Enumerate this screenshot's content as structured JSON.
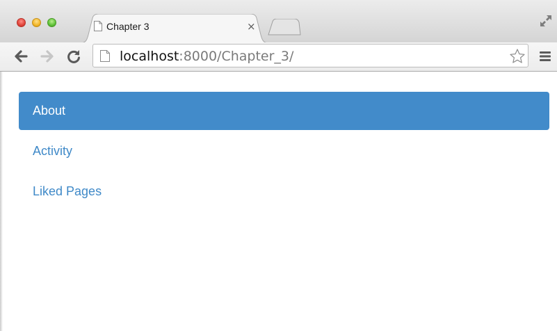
{
  "browser": {
    "tab": {
      "title": "Chapter 3",
      "close_glyph": "×",
      "icon": "page-icon"
    },
    "toolbar": {
      "back_icon": "back-arrow-icon",
      "forward_icon": "forward-arrow-icon",
      "reload_icon": "reload-icon",
      "menu_icon": "hamburger-menu-icon",
      "bookmark_icon": "star-icon"
    },
    "address": {
      "host": "localhost",
      "rest": ":8000/Chapter_3/"
    }
  },
  "nav": {
    "items": [
      {
        "label": "About",
        "active": true
      },
      {
        "label": "Activity",
        "active": false
      },
      {
        "label": "Liked Pages",
        "active": false
      }
    ]
  },
  "colors": {
    "active_bg": "#428bca",
    "link": "#3f89c8",
    "active_text": "#ffffff"
  }
}
